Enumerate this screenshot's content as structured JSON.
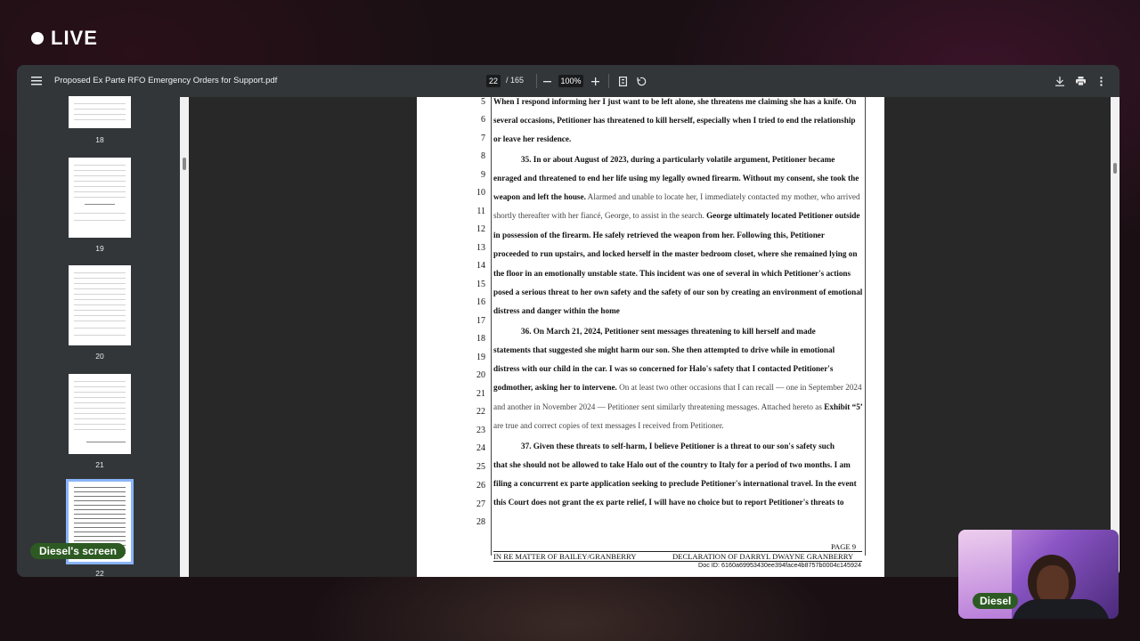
{
  "stream": {
    "live_label": "LIVE",
    "screen_label": "Diesel's screen",
    "camera_name": "Diesel"
  },
  "toolbar": {
    "menu_icon": "menu-icon",
    "file_title": "Proposed Ex Parte RFO Emergency Orders for Support.pdf",
    "current_page": "22",
    "page_total": "/ 165",
    "zoom_out_icon": "minus-icon",
    "zoom_level": "100%",
    "zoom_in_icon": "plus-icon",
    "fit_icon": "fit-page-icon",
    "rotate_icon": "rotate-icon",
    "download_icon": "download-icon",
    "print_icon": "print-icon",
    "more_icon": "more-vert-icon"
  },
  "sidebar": {
    "thumbnails": [
      {
        "label": "18"
      },
      {
        "label": "19"
      },
      {
        "label": "20"
      },
      {
        "label": "21"
      },
      {
        "label": "22",
        "selected": true
      }
    ]
  },
  "document": {
    "lines": [
      {
        "num": "5",
        "text": "When I respond informing her I just want to be left alone, she threatens me claiming she has a knife. On"
      },
      {
        "num": "6",
        "text": "several occasions, Petitioner has threatened to kill herself, especially when I tried to end the relationship"
      },
      {
        "num": "7",
        "text": "or leave her residence."
      },
      {
        "num": "8",
        "text": ""
      },
      {
        "num": "9",
        "text": "35.      In or about August of 2023, during a particularly volatile argument, Petitioner became"
      },
      {
        "num": "10",
        "text": "enraged and threatened to end her life using my legally owned firearm. Without my consent, she took the"
      },
      {
        "num": "11",
        "text": "weapon and left the house."
      },
      {
        "num": "12",
        "text": "shortly thereafter with her fiancé, George, to assist in the search."
      },
      {
        "num": "13",
        "text": "in possession of the firearm. He safely retrieved the weapon from her. Following this, Petitioner"
      },
      {
        "num": "14",
        "text": "proceeded to run upstairs, and locked herself in the master bedroom closet, where she remained lying on"
      },
      {
        "num": "15",
        "text": "the floor in an emotionally unstable state. This incident was one of several in which Petitioner's actions"
      },
      {
        "num": "16",
        "text": "posed a serious threat to her own safety and the safety of our son by creating an environment of emotional"
      },
      {
        "num": "17",
        "text": "distress and danger within the home"
      },
      {
        "num": "18",
        "text": "36.      On March 21, 2024, Petitioner sent messages threatening to kill herself and made"
      },
      {
        "num": "19",
        "text": "statements that suggested she might harm our son. She then attempted to drive while in emotional"
      },
      {
        "num": "20",
        "text": "distress with our child in the car. I was so concerned for Halo's safety that I contacted Petitioner's"
      },
      {
        "num": "21",
        "text": "godmother, asking her to intervene."
      },
      {
        "num": "22",
        "text": "and another in November 2024 — Petitioner sent similarly threatening messages. Attached hereto as"
      },
      {
        "num": "23",
        "text": "are true and correct copies of text messages I received from Petitioner."
      },
      {
        "num": "24",
        "text": "37.      Given these threats to self-harm, I believe Petitioner is a threat to our son's safety such"
      },
      {
        "num": "25",
        "text": "that she should not be allowed to take Halo out of the country to Italy for a period of two months. I am"
      },
      {
        "num": "26",
        "text": "filing a concurrent ex parte application seeking to preclude Petitioner's international travel. In the event"
      },
      {
        "num": "27",
        "text": "this Court does not grant the ex parte relief, I will have no choice but to report Petitioner's threats to"
      },
      {
        "num": "28",
        "text": ""
      }
    ],
    "line11_light": " Alarmed and unable to locate her, I immediately contacted my mother, who arrived",
    "line12_bold": " George ultimately located Petitioner outside",
    "line21_light": " On at least two other occasions that I can recall — one in September 2024",
    "line22_bold": " Exhibit “5”",
    "footer": {
      "page": "PAGE 9",
      "matter": "IN RE MATTER OF  BAILEY/GRANBERRY",
      "declaration": "DECLARATION OF DARRYL DWAYNE GRANBERRY",
      "doc_id": "Doc ID: 6160a69953430ee394face4b8757b0004c145924"
    }
  }
}
